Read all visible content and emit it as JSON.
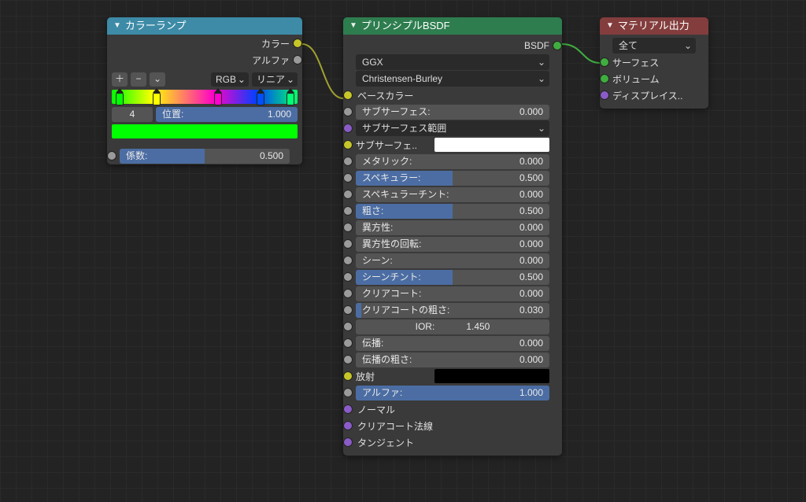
{
  "ramp": {
    "title": "カラーランプ",
    "out_color": "カラー",
    "out_alpha": "アルファ",
    "btn_add": "＋",
    "btn_sub": "−",
    "mode1": "RGB",
    "mode2": "リニア",
    "index_value": "4",
    "pos_label": "位置:",
    "pos_value": "1.000",
    "fac_label": "係数:",
    "fac_value": "0.500"
  },
  "bsdf": {
    "title": "プリンシプルBSDF",
    "out": "BSDF",
    "dist": "GGX",
    "sss": "Christensen-Burley",
    "inputs": [
      {
        "label": "ベースカラー",
        "type": "label",
        "sock": "yellow"
      },
      {
        "label": "サブサーフェス:",
        "val": "0.000",
        "fill": 0,
        "sock": "grey"
      },
      {
        "label": "サブサーフェス範囲",
        "type": "select",
        "sock": "purple"
      },
      {
        "label": "サブサーフェ..",
        "type": "swatch",
        "color": "#ffffff",
        "sock": "yellow"
      },
      {
        "label": "メタリック:",
        "val": "0.000",
        "fill": 0,
        "sock": "grey"
      },
      {
        "label": "スペキュラー:",
        "val": "0.500",
        "fill": 50,
        "sock": "grey"
      },
      {
        "label": "スペキュラーチント:",
        "val": "0.000",
        "fill": 0,
        "sock": "grey"
      },
      {
        "label": "粗さ:",
        "val": "0.500",
        "fill": 50,
        "sock": "grey"
      },
      {
        "label": "異方性:",
        "val": "0.000",
        "fill": 0,
        "sock": "grey"
      },
      {
        "label": "異方性の回転:",
        "val": "0.000",
        "fill": 0,
        "sock": "grey"
      },
      {
        "label": "シーン:",
        "val": "0.000",
        "fill": 0,
        "sock": "grey"
      },
      {
        "label": "シーンチント:",
        "val": "0.500",
        "fill": 50,
        "sock": "grey"
      },
      {
        "label": "クリアコート:",
        "val": "0.000",
        "fill": 0,
        "sock": "grey"
      },
      {
        "label": "クリアコートの粗さ:",
        "val": "0.030",
        "fill": 3,
        "sock": "grey"
      },
      {
        "label": "IOR:",
        "val": "1.450",
        "fill": 0,
        "center": true,
        "sock": "grey"
      },
      {
        "label": "伝播:",
        "val": "0.000",
        "fill": 0,
        "sock": "grey"
      },
      {
        "label": "伝播の粗さ:",
        "val": "0.000",
        "fill": 0,
        "sock": "grey"
      },
      {
        "label": "放射",
        "type": "swatch",
        "color": "#000000",
        "sock": "yellow"
      },
      {
        "label": "アルファ:",
        "val": "1.000",
        "fill": 100,
        "sock": "grey"
      },
      {
        "label": "ノーマル",
        "type": "label",
        "sock": "purple"
      },
      {
        "label": "クリアコート法線",
        "type": "label",
        "sock": "purple"
      },
      {
        "label": "タンジェント",
        "type": "label",
        "sock": "purple"
      }
    ]
  },
  "out": {
    "title": "マテリアル出力",
    "target": "全て",
    "inputs": [
      {
        "label": "サーフェス",
        "sock": "green"
      },
      {
        "label": "ボリューム",
        "sock": "green"
      },
      {
        "label": "ディスプレイス..",
        "sock": "purple"
      }
    ]
  }
}
